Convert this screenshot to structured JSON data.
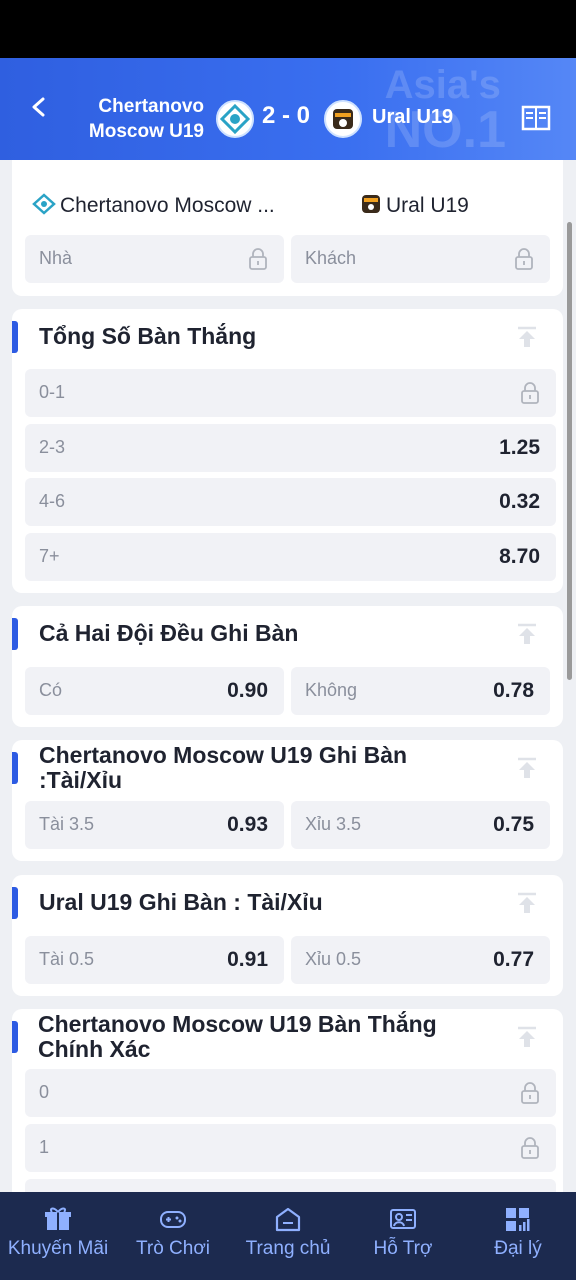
{
  "header": {
    "team_home": "Chertanovo Moscow U19",
    "team_home_line1": "Chertanovo",
    "team_home_line2": "Moscow U19",
    "score": "2 - 0",
    "team_away": "Ural U19",
    "watermark_line1": "Asia's",
    "watermark_line2": "NO.1"
  },
  "card_1x2": {
    "home_team_short": "Chertanovo Moscow ...",
    "away_team": "Ural U19",
    "home_label": "Nhà",
    "away_label": "Khách"
  },
  "total_goals": {
    "title": "Tổng Số Bàn Thắng",
    "rows": [
      {
        "label": "0-1",
        "value": "",
        "locked": true
      },
      {
        "label": "2-3",
        "value": "1.25",
        "locked": false
      },
      {
        "label": "4-6",
        "value": "0.32",
        "locked": false
      },
      {
        "label": "7+",
        "value": "8.70",
        "locked": false
      }
    ]
  },
  "btts": {
    "title": "Cả Hai Đội Đều Ghi Bàn",
    "yes_label": "Có",
    "yes_value": "0.90",
    "no_label": "Không",
    "no_value": "0.78"
  },
  "home_ou": {
    "title_line1": "Chertanovo Moscow U19 Ghi Bàn",
    "title_line2": ":Tài/Xỉu",
    "over_label": "Tài 3.5",
    "over_value": "0.93",
    "under_label": "Xỉu 3.5",
    "under_value": "0.75"
  },
  "away_ou": {
    "title": "Ural U19 Ghi Bàn : Tài/Xỉu",
    "over_label": "Tài 0.5",
    "over_value": "0.91",
    "under_label": "Xỉu 0.5",
    "under_value": "0.77"
  },
  "exact_goals": {
    "title_line1": "Chertanovo Moscow U19 Bàn Thắng",
    "title_line2": "Chính Xác",
    "rows": [
      {
        "label": "0",
        "locked": true
      },
      {
        "label": "1",
        "locked": true
      }
    ]
  },
  "bottom_nav": [
    {
      "label": "Khuyến Mãi",
      "icon": "gift-icon"
    },
    {
      "label": "Trò Chơi",
      "icon": "gamepad-icon"
    },
    {
      "label": "Trang chủ",
      "icon": "home-icon"
    },
    {
      "label": "Hỗ Trợ",
      "icon": "support-icon"
    },
    {
      "label": "Đại lý",
      "icon": "agent-icon"
    }
  ],
  "colors": {
    "header_blue": "#3a6ff0",
    "accent_bar": "#2d5be3",
    "nav_bg": "#1c2a4f",
    "nav_text": "#8fb0ff"
  }
}
